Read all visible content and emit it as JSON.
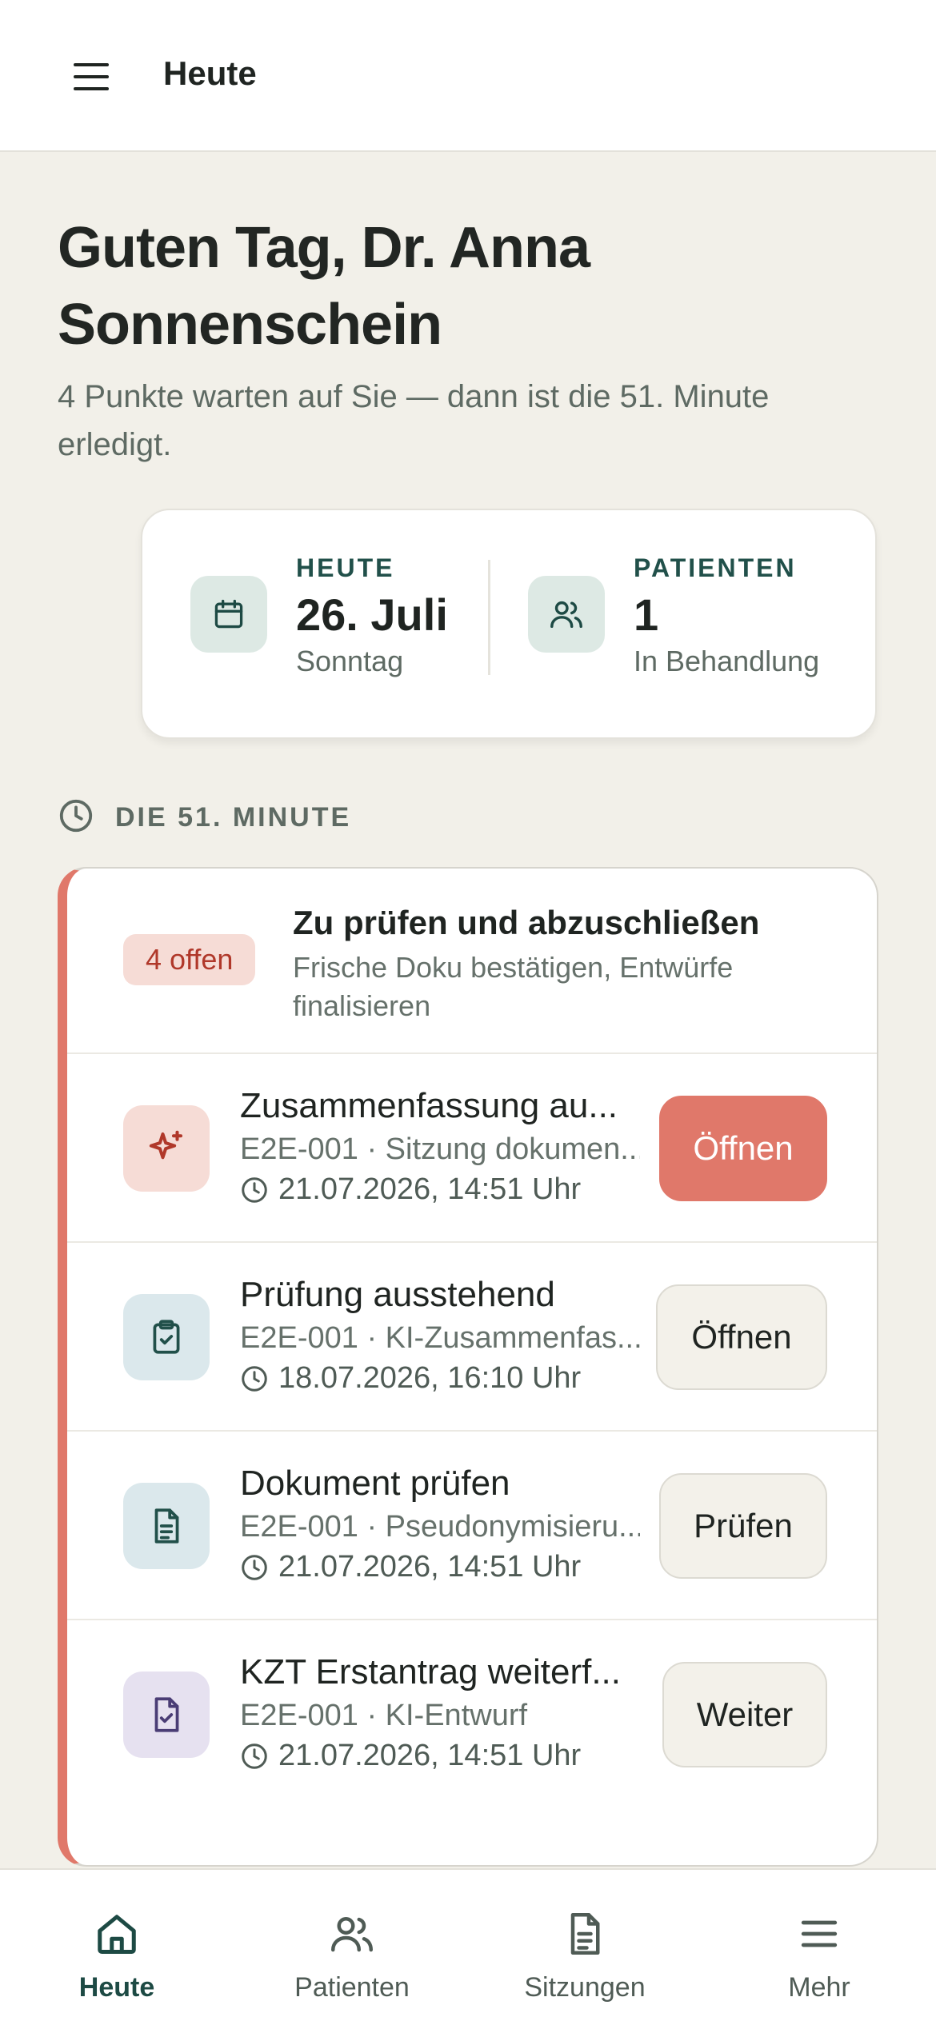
{
  "colors": {
    "background": "#f2f0e9",
    "accent": "#e0786a",
    "primary_green": "#1d4a44",
    "badge_bg": "#f6dcd6",
    "badge_text": "#b0382a"
  },
  "topbar": {
    "menu_icon": "hamburger-menu-icon",
    "title": "Heute"
  },
  "greeting": {
    "title": "Guten Tag, Dr. Anna Sonnenschein",
    "subline": "4 Punkte warten auf Sie — dann ist die 51. Minute erledigt."
  },
  "stats": {
    "today": {
      "icon": "calendar-icon",
      "label": "HEUTE",
      "value": "26. Juli",
      "sub": "Sonntag"
    },
    "patients": {
      "icon": "users-icon",
      "label": "PATIENTEN",
      "value": "1",
      "sub": "In Behandlung"
    }
  },
  "section": {
    "icon": "clock-icon",
    "label": "DIE 51. MINUTE"
  },
  "tasks": {
    "badge": "4 offen",
    "title": "Zu prüfen und abzuschließen",
    "subtitle": "Frische Doku bestätigen, Entwürfe finalisieren",
    "items": [
      {
        "icon": "sparkle-icon",
        "title": "Zusammenfassung au...",
        "meta": "E2E-001 · Sitzung dokumen...",
        "time": "21.07.2026, 14:51 Uhr",
        "button": "Öffnen",
        "primary": true
      },
      {
        "icon": "clipboard-check-icon",
        "title": "Prüfung ausstehend",
        "meta": "E2E-001 · KI-Zusammenfas...",
        "time": "18.07.2026, 16:10 Uhr",
        "button": "Öffnen",
        "primary": false
      },
      {
        "icon": "document-icon",
        "title": "Dokument prüfen",
        "meta": "E2E-001 · Pseudonymisieru...",
        "time": "21.07.2026, 14:51 Uhr",
        "button": "Prüfen",
        "primary": false
      },
      {
        "icon": "file-check-icon",
        "title": "KZT Erstantrag weiterf...",
        "meta": "E2E-001 · KI-Entwurf",
        "time": "21.07.2026, 14:51 Uhr",
        "button": "Weiter",
        "primary": false
      }
    ]
  },
  "bottom_nav": [
    {
      "label": "Heute",
      "icon": "home-icon",
      "active": true
    },
    {
      "label": "Patienten",
      "icon": "users-icon",
      "active": false
    },
    {
      "label": "Sitzungen",
      "icon": "document-icon",
      "active": false
    },
    {
      "label": "Mehr",
      "icon": "menu-icon",
      "active": false
    }
  ]
}
